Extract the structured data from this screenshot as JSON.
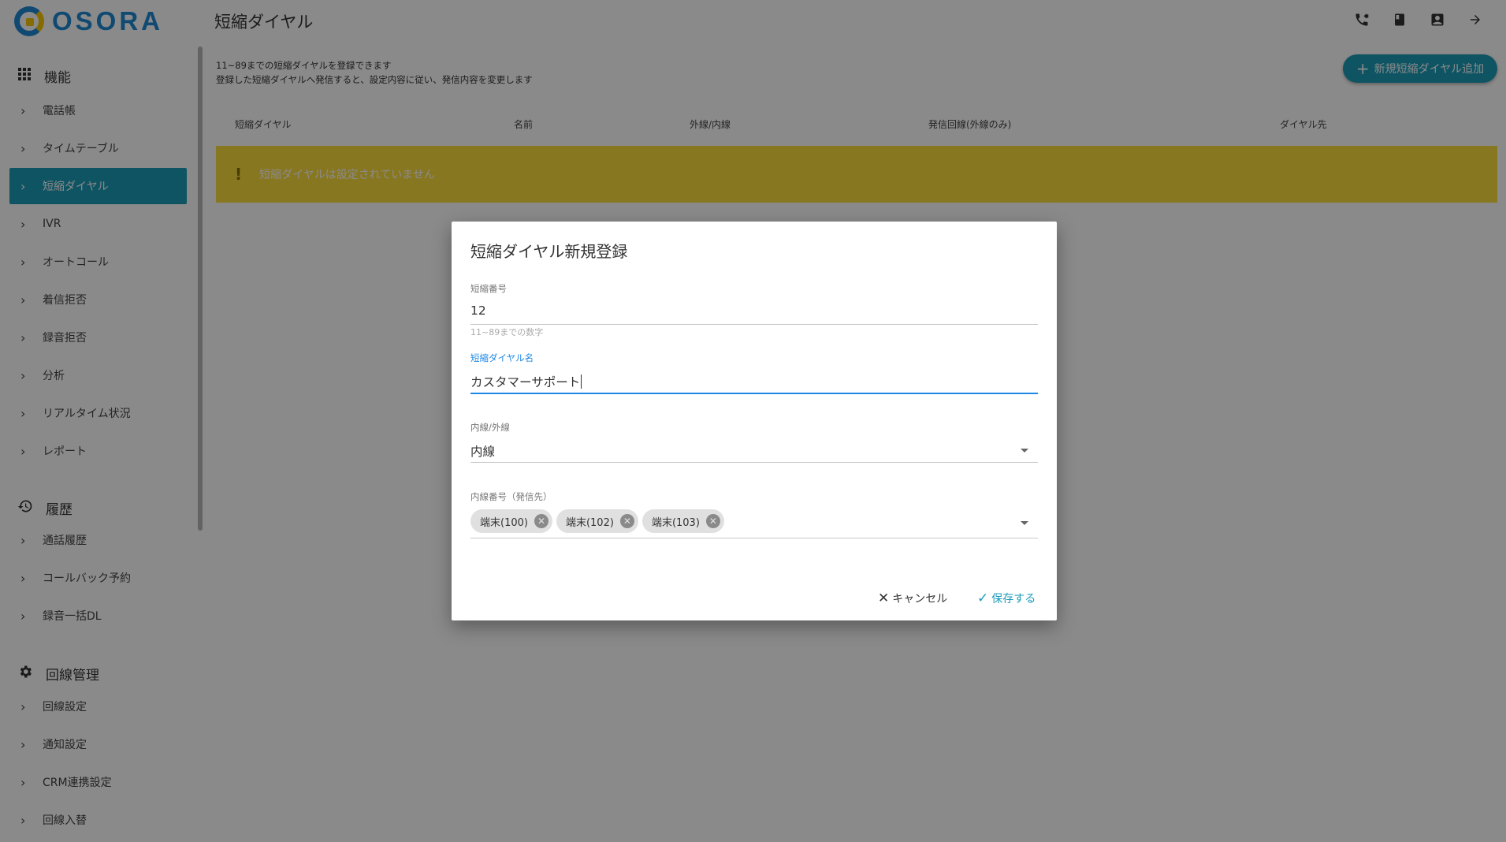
{
  "app": {
    "logo_text": "OSORA",
    "page_title": "短縮ダイヤル"
  },
  "header_icons": [
    "phone-incoming-icon",
    "book-icon",
    "contact-icon",
    "logout-arrow-icon"
  ],
  "sidebar": {
    "sections": [
      {
        "label": "機能",
        "icon": "grid-icon"
      },
      {
        "label": "履歴",
        "icon": "history-icon"
      },
      {
        "label": "回線管理",
        "icon": "gear-icon"
      }
    ],
    "items": [
      {
        "label": "電話帳"
      },
      {
        "label": "タイムテーブル"
      },
      {
        "label": "短縮ダイヤル",
        "active": true
      },
      {
        "label": "IVR"
      },
      {
        "label": "オートコール"
      },
      {
        "label": "着信拒否"
      },
      {
        "label": "録音拒否"
      },
      {
        "label": "分析"
      },
      {
        "label": "リアルタイム状況"
      },
      {
        "label": "レポート"
      },
      {
        "label": "通話履歴"
      },
      {
        "label": "コールバック予約"
      },
      {
        "label": "録音一括DL"
      },
      {
        "label": "回線設定"
      },
      {
        "label": "通知設定"
      },
      {
        "label": "CRM連携設定"
      },
      {
        "label": "回線入替"
      }
    ]
  },
  "main": {
    "description_line1": "11~89までの短縮ダイヤルを登録できます",
    "description_line2": "登録した短縮ダイヤルへ発信すると、設定内容に従い、発信内容を変更します",
    "add_button_label": "新規短縮ダイヤル追加",
    "columns": [
      "短縮ダイヤル",
      "名前",
      "外線/内線",
      "発信回線(外線のみ)",
      "ダイヤル先"
    ],
    "empty_message": "短縮ダイヤルは設定されていません",
    "accent_color": "#1b9bb7",
    "warning_color": "#fbdc3d"
  },
  "dialog": {
    "title": "短縮ダイヤル新規登録",
    "fields": {
      "number": {
        "label": "短縮番号",
        "value": "12",
        "hint": "11~89までの数字"
      },
      "name": {
        "label": "短縮ダイヤル名",
        "value": "カスタマーサポート"
      },
      "line_type": {
        "label": "内線/外線",
        "value": "内線"
      },
      "extensions": {
        "label": "内線番号（発信先）",
        "chips": [
          "端末(100)",
          "端末(102)",
          "端末(103)"
        ]
      }
    },
    "cancel_label": "キャンセル",
    "save_label": "保存する"
  }
}
